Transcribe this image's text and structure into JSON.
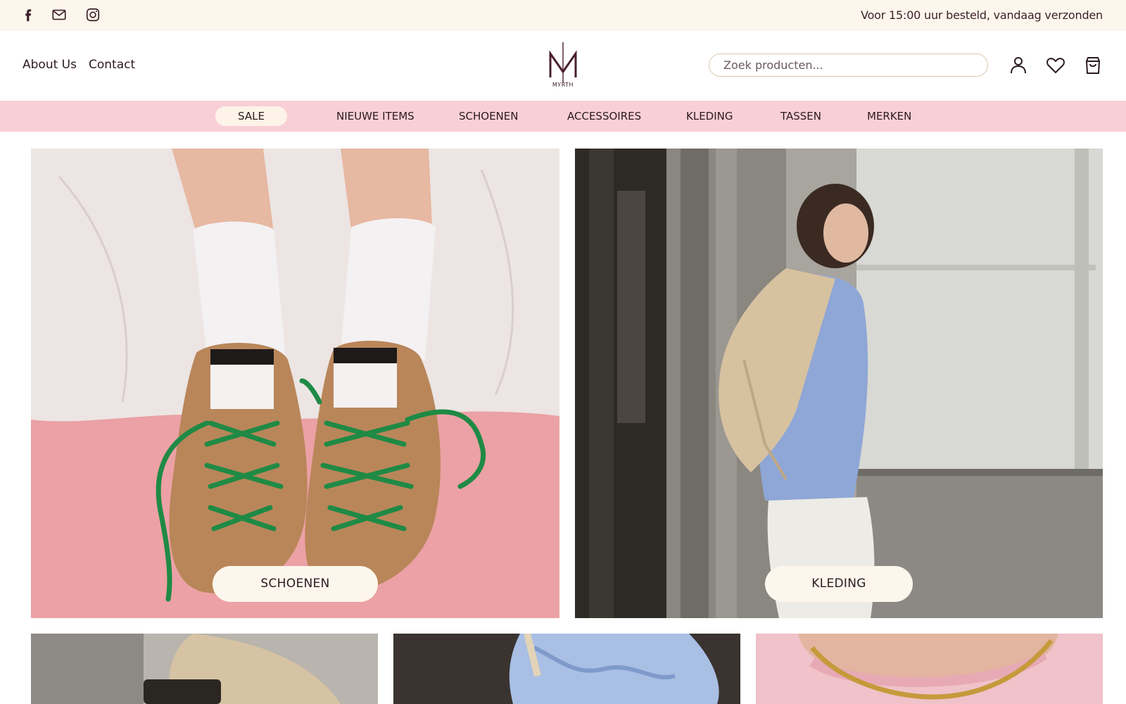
{
  "topbar": {
    "social": [
      "facebook-icon",
      "mail-icon",
      "instagram-icon"
    ],
    "promo": "Voor 15:00 uur besteld, vandaag verzonden"
  },
  "header": {
    "links": [
      "About Us",
      "Contact"
    ],
    "logo_text": "MYRTH",
    "search_placeholder": "Zoek producten...",
    "icons": [
      "account-icon",
      "wishlist-heart-icon",
      "cart-bag-icon"
    ]
  },
  "nav": {
    "items": [
      "SALE",
      "NIEUWE ITEMS",
      "SCHOENEN",
      "ACCESSOIRES",
      "KLEDING",
      "TASSEN",
      "MERKEN"
    ]
  },
  "hero": {
    "tiles": [
      {
        "label": "SCHOENEN"
      },
      {
        "label": "KLEDING"
      }
    ]
  },
  "colors": {
    "topbar_bg": "#fdf6ec",
    "nav_bg": "#f9cfd6",
    "brand": "#4a1f2e",
    "button_bg": "#fdf6ec"
  }
}
